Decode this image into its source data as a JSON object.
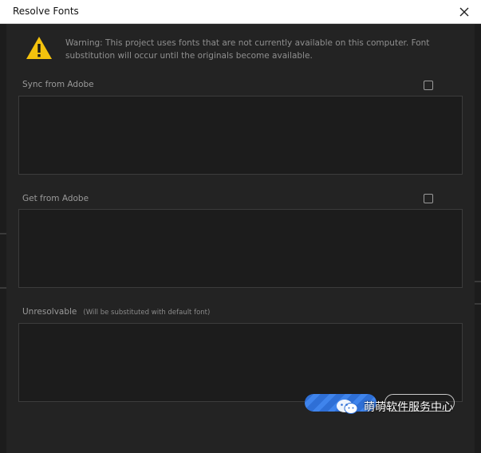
{
  "window": {
    "title": "Resolve Fonts"
  },
  "warning": {
    "text": "Warning: This project uses fonts that are not currently available on this computer. Font substitution will occur until the originals become available."
  },
  "sections": [
    {
      "label": "Sync from Adobe",
      "note": "",
      "has_checkbox": true,
      "checked": false
    },
    {
      "label": "Get from Adobe",
      "note": "",
      "has_checkbox": true,
      "checked": false
    },
    {
      "label": "Unresolvable",
      "note": "(Will be substituted with default font)",
      "has_checkbox": false
    }
  ],
  "watermark": {
    "text": "萌萌软件服务中心"
  },
  "colors": {
    "warning_yellow": "#f4c20d",
    "primary_blue": "#2e6fd6",
    "background": "#232323",
    "panel": "#1c1c1c"
  }
}
